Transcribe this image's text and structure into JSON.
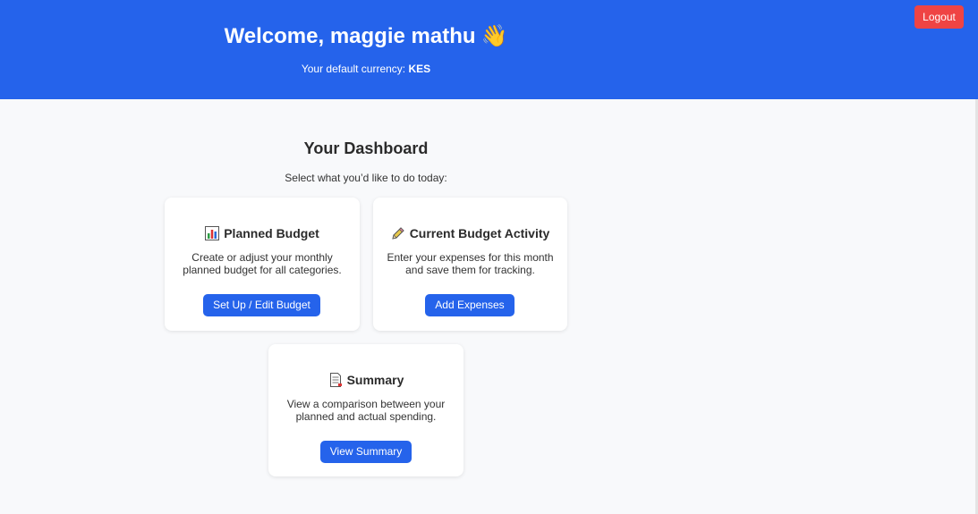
{
  "header": {
    "welcome_text": "Welcome, maggie mathu",
    "wave_emoji": "👋",
    "currency_label": "Your default currency:",
    "currency_value": "KES",
    "logout_label": "Logout"
  },
  "dashboard": {
    "title": "Your Dashboard",
    "subtitle": "Select what you’d like to do today:"
  },
  "cards": [
    {
      "icon": "bar-chart-icon",
      "title": "Planned Budget",
      "description": "Create or adjust your monthly planned budget for all categories.",
      "button_label": "Set Up / Edit Budget"
    },
    {
      "icon": "pencil-icon",
      "title": "Current Budget Activity",
      "description": "Enter your expenses for this month and save them for tracking.",
      "button_label": "Add Expenses"
    },
    {
      "icon": "document-icon",
      "title": "Summary",
      "description": "View a comparison between your planned and actual spending.",
      "button_label": "View Summary"
    }
  ],
  "colors": {
    "header_bg": "#2563eb",
    "button_primary": "#2563eb",
    "logout_bg": "#ef4444",
    "page_bg": "#f8f9fb"
  }
}
